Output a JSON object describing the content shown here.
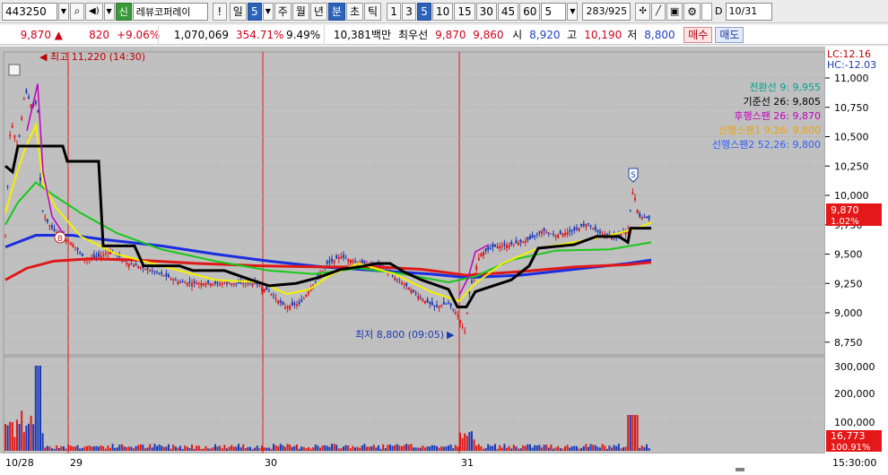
{
  "toolbar": {
    "code": "443250",
    "badge": "신",
    "stock_name": "레뷰코퍼레이",
    "alert": "!",
    "period_day": "일",
    "period_num": "5",
    "period_week": "주",
    "period_month": "월",
    "period_year": "년",
    "period_minute": "분",
    "period_tick": "초",
    "period_tick2": "틱",
    "intervals": [
      "1",
      "3",
      "5",
      "10",
      "15",
      "30",
      "45",
      "60"
    ],
    "interval_value": "5",
    "count": "283",
    "count_total": "/925",
    "date": "10/31",
    "checkbox_label": "D"
  },
  "quote": {
    "price": "9,870 ▲",
    "change": "820",
    "change_pct": "+9.06%",
    "volume": "1,070,069",
    "vol_ratio": "354.71%",
    "turnover": "9.49%",
    "amount": "10,381백만",
    "best_ask_label": "최우선",
    "best_ask": "9,870",
    "best_bid": "9,860",
    "open_label": "시",
    "open": "8,920",
    "high_label": "고",
    "high": "10,190",
    "low_label": "저",
    "low": "8,800",
    "buy": "매수",
    "sell": "매도"
  },
  "chart": {
    "lc": "LC:12.16",
    "hc": "HC:-12.03",
    "price_axis": [
      "11,000",
      "10,750",
      "10,500",
      "10,250",
      "10,000",
      "9,750",
      "9,500",
      "9,250",
      "9,000",
      "8,750"
    ],
    "current_price": "9,870",
    "current_pct": "1.02%",
    "volume_axis": [
      "300,000",
      "200,000",
      "100,000"
    ],
    "current_volume": "16,773",
    "current_vol_pct": "100.91%",
    "max_label": "최고 11,220 (14:30)",
    "min_label": "최저 8,800 (09:05)",
    "x_labels": [
      "10/28",
      "29",
      "30",
      "31"
    ],
    "time_label": "15:30:00",
    "marker_s": "S",
    "marker_b": "B",
    "legend": [
      {
        "text": "전환선 9: 9,955",
        "color": "#00a28c"
      },
      {
        "text": "기준선 26: 9,805",
        "color": "#000000"
      },
      {
        "text": "후행스팬 26: 9,870",
        "color": "#c000c0"
      },
      {
        "text": "선행스팬1 9,26: 9,800",
        "color": "#f0a000"
      },
      {
        "text": "선행스팬2 52,26: 9,800",
        "color": "#3060ff"
      }
    ]
  }
}
